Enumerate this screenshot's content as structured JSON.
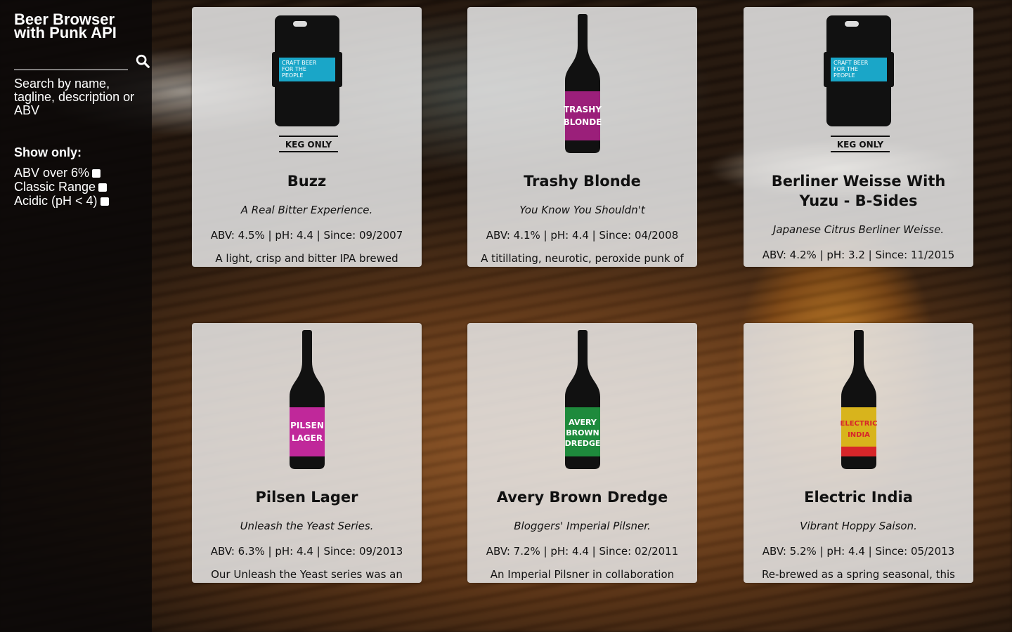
{
  "app": {
    "title": "Beer Browser with Punk API"
  },
  "search": {
    "value": "",
    "placeholder": "",
    "hint": "Search by name, tagline, description or ABV",
    "icon": "search-icon"
  },
  "filters": {
    "title": "Show only:",
    "items": [
      {
        "label": "ABV over 6%",
        "checked": false
      },
      {
        "label": "Classic Range",
        "checked": false
      },
      {
        "label": "Acidic (pH < 4)",
        "checked": false
      }
    ]
  },
  "beers": [
    {
      "name": "Buzz",
      "tagline": "A Real Bitter Experience.",
      "stats": "ABV: 4.5% | pH: 4.4 | Since: 09/2007",
      "description": "A light, crisp and bitter IPA brewed with",
      "image": "keg",
      "keg_label": "KEG ONLY",
      "label_color": "#1aa6c8",
      "label_lines": [
        "CRAFT BEER",
        "FOR THE",
        "PEOPLE"
      ]
    },
    {
      "name": "Trashy Blonde",
      "tagline": "You Know You Shouldn't",
      "stats": "ABV: 4.1% | pH: 4.4 | Since: 04/2008",
      "description": "A titillating, neurotic, peroxide punk of a",
      "image": "bottle",
      "label_color": "#9b1f7a",
      "label_lines": [
        "TRASHY",
        "BLONDE"
      ]
    },
    {
      "name": "Berliner Weisse With Yuzu - B-Sides",
      "tagline": "Japanese Citrus Berliner Weisse.",
      "stats": "ABV: 4.2% | pH: 3.2 | Since: 11/2015",
      "description": "",
      "image": "keg",
      "keg_label": "KEG ONLY",
      "label_color": "#1aa6c8",
      "label_lines": [
        "CRAFT BEER",
        "FOR THE",
        "PEOPLE"
      ]
    },
    {
      "name": "Pilsen Lager",
      "tagline": "Unleash the Yeast Series.",
      "stats": "ABV: 6.3% | pH: 4.4 | Since: 09/2013",
      "description": "Our Unleash the Yeast series was an epic",
      "image": "bottle",
      "label_color": "#c0289a",
      "label_lines": [
        "PILSEN",
        "LAGER"
      ]
    },
    {
      "name": "Avery Brown Dredge",
      "tagline": "Bloggers' Imperial Pilsner.",
      "stats": "ABV: 7.2% | pH: 4.4 | Since: 02/2011",
      "description": "An Imperial Pilsner in collaboration with",
      "image": "bottle",
      "label_color": "#1e8a3c",
      "label_lines": [
        "AVERY",
        "BROWN",
        "DREDGE"
      ]
    },
    {
      "name": "Electric India",
      "tagline": "Vibrant Hoppy Saison.",
      "stats": "ABV: 5.2% | pH: 4.4 | Since: 05/2013",
      "description": "Re-brewed as a spring seasonal, this beer",
      "image": "bottle",
      "label_color": "#d8b41c",
      "label_accent": "#d7262a",
      "label_lines": [
        "ELECTRIC",
        "INDIA"
      ]
    }
  ]
}
